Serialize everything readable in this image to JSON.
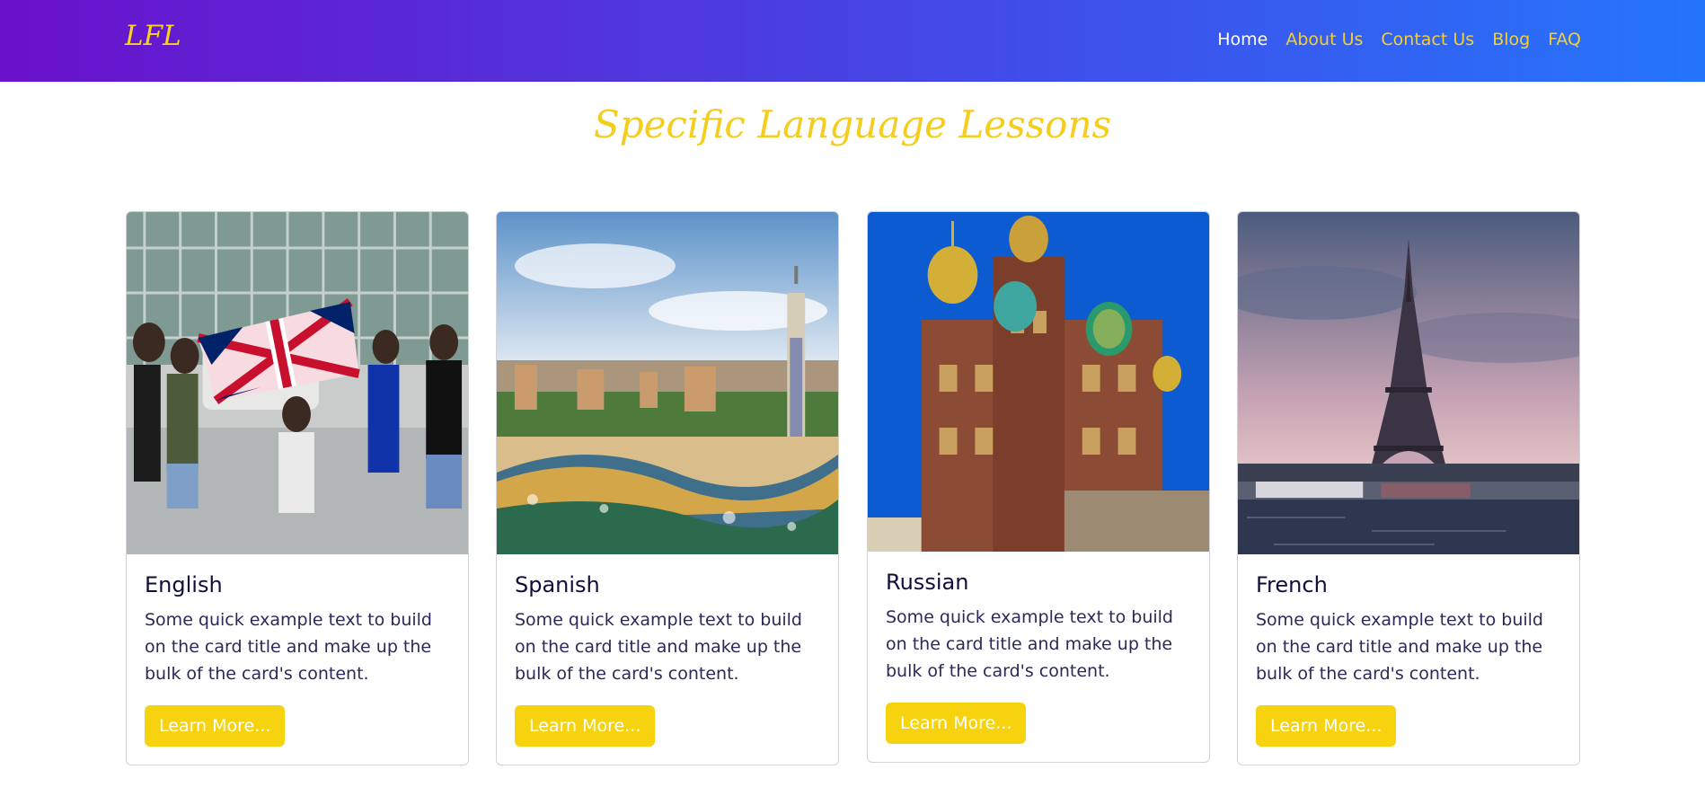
{
  "brand": "LFL",
  "nav": [
    {
      "label": "Home",
      "active": true
    },
    {
      "label": "About Us"
    },
    {
      "label": "Contact Us"
    },
    {
      "label": "Blog"
    },
    {
      "label": "FAQ"
    }
  ],
  "page_title": "Specific Language Lessons",
  "cards": [
    {
      "title": "English",
      "text": "Some quick example text to build on the card title and make up the bulk of the card's content.",
      "button": "Learn More..."
    },
    {
      "title": "Spanish",
      "text": "Some quick example text to build on the card title and make up the bulk of the card's content.",
      "button": "Learn More..."
    },
    {
      "title": "Russian",
      "text": "Some quick example text to build on the card title and make up the bulk of the card's content.",
      "button": "Learn More..."
    },
    {
      "title": "French",
      "text": "Some quick example text to build on the card title and make up the bulk of the card's content.",
      "button": "Learn More..."
    }
  ],
  "colors": {
    "gradient_start": "#6a11cb",
    "gradient_end": "#2575fc",
    "accent": "#f7d30f",
    "nav_link": "#f4cf33"
  }
}
